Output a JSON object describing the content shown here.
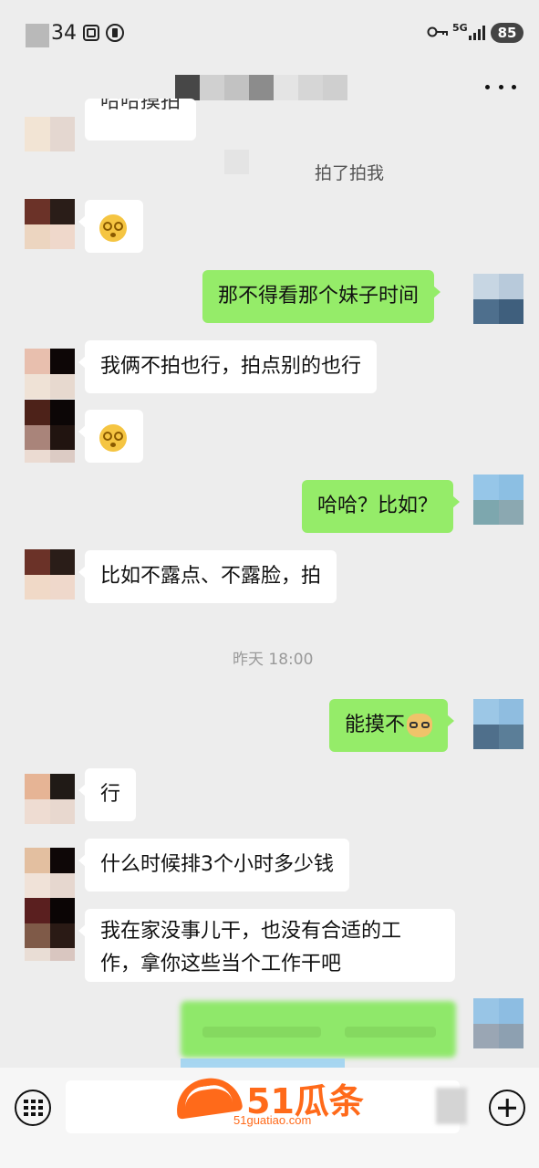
{
  "status_bar": {
    "time": "34",
    "network": "5G",
    "battery": "85",
    "icons": [
      "screenshot-icon",
      "nfc-icon",
      "key-icon",
      "signal-icon",
      "battery-icon"
    ]
  },
  "header": {
    "title_obscured": true,
    "more_label": "more-icon"
  },
  "messages": [
    {
      "side": "left",
      "text": "哈哈摸拍",
      "partial": true
    },
    {
      "side": "system",
      "type": "nudge",
      "text": "拍了拍我"
    },
    {
      "side": "left",
      "emoji": "dizzy-face-emoji"
    },
    {
      "side": "right",
      "text": "那不得看那个妹子时间"
    },
    {
      "side": "left",
      "text": "我俩不拍也行，拍点别的也行"
    },
    {
      "side": "left",
      "emoji": "dizzy-face-emoji"
    },
    {
      "side": "right",
      "text": "哈哈？比如？"
    },
    {
      "side": "left",
      "text": "比如不露点、不露脸，拍"
    },
    {
      "side": "system",
      "type": "time",
      "text": "昨天 18:00"
    },
    {
      "side": "right",
      "text": "能摸不",
      "emoji": "doge-emoji"
    },
    {
      "side": "left",
      "text": "行"
    },
    {
      "side": "left",
      "text": "什么时候排3个小时多少钱"
    },
    {
      "side": "left",
      "text": "我在家没事儿干，也没有合适的工作，拿你这些当个工作干吧"
    },
    {
      "side": "right",
      "text": "",
      "blurred": true
    }
  ],
  "watermark": {
    "brand": "51瓜条",
    "url": "51guatiao.com"
  },
  "colors": {
    "background": "#ededed",
    "bubble_right": "#95ec69",
    "bubble_left": "#ffffff",
    "watermark": "#ff6a1a"
  }
}
